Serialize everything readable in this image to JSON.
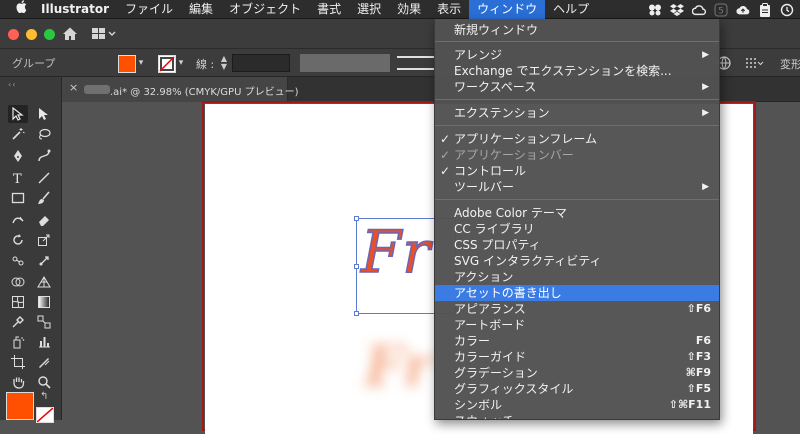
{
  "menubar": {
    "app_name": "Illustrator",
    "items": [
      "ファイル",
      "編集",
      "オブジェクト",
      "書式",
      "選択",
      "効果",
      "表示",
      "ウィンドウ",
      "ヘルプ"
    ],
    "active_item": "ウィンドウ",
    "status_badge": "5"
  },
  "control_bar": {
    "selection_label": "グループ",
    "stroke_label": "線 :",
    "transform_label": "変形",
    "fill_color": "#FE5000"
  },
  "doc_tab": {
    "close_glyph": "×",
    "title": ".ai* @ 32.98% (CMYK/GPU プレビュー)"
  },
  "artwork": {
    "text": "Fr",
    "shadow_text": "Fr"
  },
  "window_menu": {
    "items": [
      {
        "label": "新規ウィンドウ",
        "shortcut": "",
        "submenu": false,
        "checked": false,
        "disabled": false,
        "highlighted": false
      },
      {
        "label": "アレンジ",
        "shortcut": "",
        "submenu": true,
        "checked": false,
        "disabled": false,
        "highlighted": false
      },
      {
        "label": "Exchange でエクステンションを検索...",
        "shortcut": "",
        "submenu": false,
        "checked": false,
        "disabled": false,
        "highlighted": false
      },
      {
        "label": "ワークスペース",
        "shortcut": "",
        "submenu": true,
        "checked": false,
        "disabled": false,
        "highlighted": false
      },
      {
        "label": "エクステンション",
        "shortcut": "",
        "submenu": true,
        "checked": false,
        "disabled": false,
        "highlighted": false
      },
      {
        "label": "アプリケーションフレーム",
        "shortcut": "",
        "submenu": false,
        "checked": true,
        "disabled": false,
        "highlighted": false
      },
      {
        "label": "アプリケーションバー",
        "shortcut": "",
        "submenu": false,
        "checked": true,
        "disabled": true,
        "highlighted": false
      },
      {
        "label": "コントロール",
        "shortcut": "",
        "submenu": false,
        "checked": true,
        "disabled": false,
        "highlighted": false
      },
      {
        "label": "ツールバー",
        "shortcut": "",
        "submenu": true,
        "checked": false,
        "disabled": false,
        "highlighted": false
      },
      {
        "label": "Adobe Color テーマ",
        "shortcut": "",
        "submenu": false,
        "checked": false,
        "disabled": false,
        "highlighted": false
      },
      {
        "label": "CC ライブラリ",
        "shortcut": "",
        "submenu": false,
        "checked": false,
        "disabled": false,
        "highlighted": false
      },
      {
        "label": "CSS プロパティ",
        "shortcut": "",
        "submenu": false,
        "checked": false,
        "disabled": false,
        "highlighted": false
      },
      {
        "label": "SVG インタラクティビティ",
        "shortcut": "",
        "submenu": false,
        "checked": false,
        "disabled": false,
        "highlighted": false
      },
      {
        "label": "アクション",
        "shortcut": "",
        "submenu": false,
        "checked": false,
        "disabled": false,
        "highlighted": false
      },
      {
        "label": "アセットの書き出し",
        "shortcut": "",
        "submenu": false,
        "checked": false,
        "disabled": false,
        "highlighted": true
      },
      {
        "label": "アピアランス",
        "shortcut": "⇧F6",
        "submenu": false,
        "checked": false,
        "disabled": false,
        "highlighted": false
      },
      {
        "label": "アートボード",
        "shortcut": "",
        "submenu": false,
        "checked": false,
        "disabled": false,
        "highlighted": false
      },
      {
        "label": "カラー",
        "shortcut": "F6",
        "submenu": false,
        "checked": false,
        "disabled": false,
        "highlighted": false
      },
      {
        "label": "カラーガイド",
        "shortcut": "⇧F3",
        "submenu": false,
        "checked": false,
        "disabled": false,
        "highlighted": false
      },
      {
        "label": "グラデーション",
        "shortcut": "⌘F9",
        "submenu": false,
        "checked": false,
        "disabled": false,
        "highlighted": false
      },
      {
        "label": "グラフィックスタイル",
        "shortcut": "⇧F5",
        "submenu": false,
        "checked": false,
        "disabled": false,
        "highlighted": false
      },
      {
        "label": "シンボル",
        "shortcut": "⇧⌘F11",
        "submenu": false,
        "checked": false,
        "disabled": false,
        "highlighted": false
      },
      {
        "label": "スウォッチ",
        "shortcut": "",
        "submenu": false,
        "checked": false,
        "disabled": false,
        "highlighted": false
      }
    ]
  }
}
